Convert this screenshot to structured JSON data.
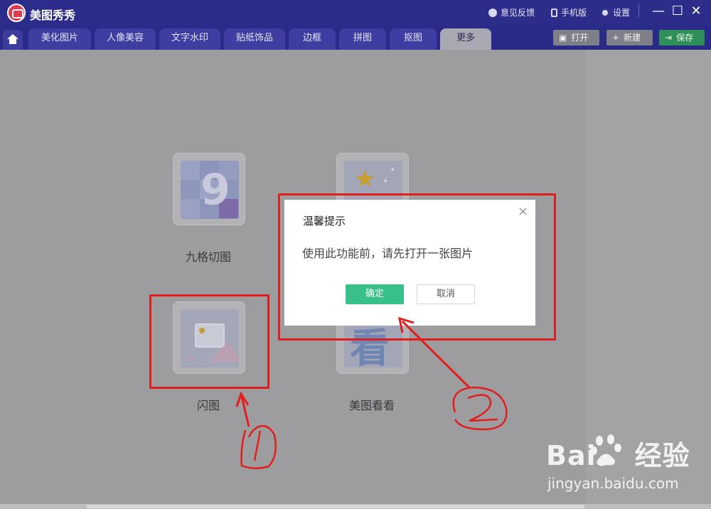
{
  "app": {
    "title": "美图秀秀"
  },
  "titlebar": {
    "feedback": "意见反馈",
    "mobile": "手机版",
    "settings": "设置",
    "minimize": "—",
    "maximize": "☐",
    "close": "✕"
  },
  "tabs": [
    {
      "label": "美化图片"
    },
    {
      "label": "人像美容"
    },
    {
      "label": "文字水印"
    },
    {
      "label": "贴纸饰品"
    },
    {
      "label": "边框"
    },
    {
      "label": "拼图"
    },
    {
      "label": "抠图"
    },
    {
      "label": "更多",
      "active": true
    }
  ],
  "actions": {
    "open": "打开",
    "new": "新建",
    "save": "保存"
  },
  "features": [
    {
      "label": "九格切图",
      "icon": "nine-grid-icon"
    },
    {
      "label": "闪图",
      "icon": "flash-image-icon"
    },
    {
      "label": "美图看看",
      "icon": "meitu-viewer-icon",
      "glyph": "看"
    }
  ],
  "dialog": {
    "title": "温馨提示",
    "message": "使用此功能前，请先打开一张图片",
    "confirm": "确定",
    "cancel": "取消",
    "close_glyph": "×"
  },
  "colors": {
    "annotation": "#e21d1d",
    "confirm": "#39c08a",
    "titlebar": "#2c2c8a"
  },
  "watermark": {
    "logo_left": "Bai",
    "logo_right": "经验",
    "url": "jingyan.baidu.com"
  }
}
